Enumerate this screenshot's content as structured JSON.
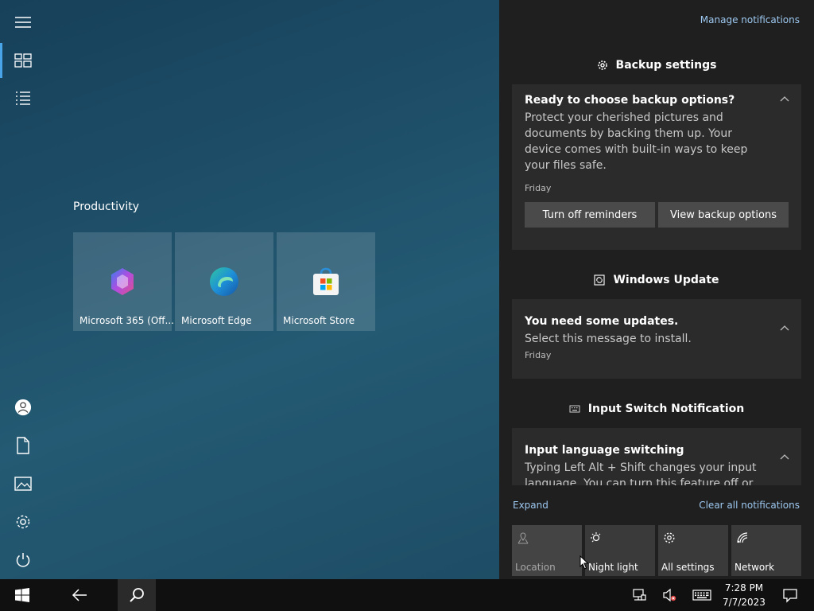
{
  "start": {
    "group_title": "Productivity",
    "tiles": [
      {
        "label": "Microsoft 365 (Off..."
      },
      {
        "label": "Microsoft Edge"
      },
      {
        "label": "Microsoft Store"
      }
    ]
  },
  "action_center": {
    "manage_label": "Manage notifications",
    "sections": [
      {
        "header": "Backup settings",
        "icon": "gear-icon",
        "title": "Ready to choose backup options?",
        "body": "Protect your cherished pictures and documents by backing them up. Your device comes with built-in ways to keep your files safe.",
        "time": "Friday",
        "buttons": [
          "Turn off reminders",
          "View backup options"
        ]
      },
      {
        "header": "Windows Update",
        "icon": "refresh-icon",
        "title": "You need some updates.",
        "body": "Select this message to install.",
        "time": "Friday"
      },
      {
        "header": "Input Switch Notification",
        "icon": "keyboard-icon",
        "title": "Input language switching",
        "body": "Typing Left Alt + Shift changes your input language. You can turn this feature off or"
      }
    ],
    "expand_label": "Expand",
    "clear_label": "Clear all notifications",
    "quick_actions": [
      {
        "label": "Location",
        "icon": "location-icon",
        "enabled": false
      },
      {
        "label": "Night light",
        "icon": "night-light-icon",
        "enabled": true
      },
      {
        "label": "All settings",
        "icon": "settings-icon",
        "enabled": true
      },
      {
        "label": "Network",
        "icon": "network-icon",
        "enabled": true
      }
    ]
  },
  "taskbar": {
    "time": "7:28 PM",
    "date": "7/7/2023"
  },
  "colors": {
    "accent_link": "#9dc8f0",
    "panel_bg": "#1f1f1f",
    "card_bg": "#2b2b2b",
    "rail_active": "#4aa4e8"
  }
}
